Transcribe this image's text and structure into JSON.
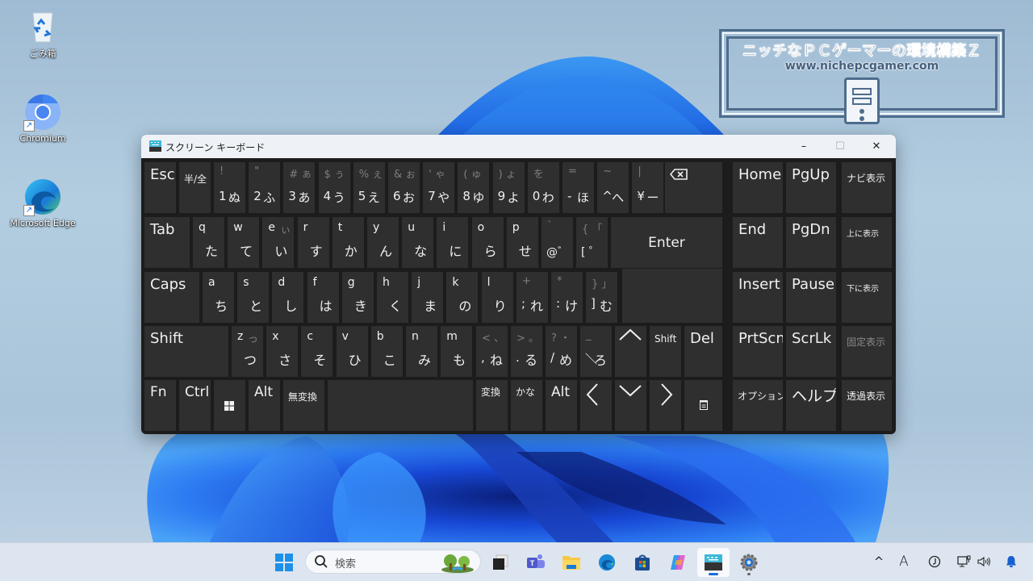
{
  "desktop": {
    "icons": [
      {
        "label": "ごみ箱",
        "icon": "recycle-bin-icon"
      },
      {
        "label": "Chromium",
        "icon": "chromium-icon",
        "shortcut": true
      },
      {
        "label": "Microsoft Edge",
        "icon": "edge-icon",
        "shortcut": true
      }
    ],
    "watermark": {
      "title": "ニッチなＰＣゲーマーの環境構築Ｚ",
      "url": "www.nichepcgamer.com"
    }
  },
  "osk": {
    "title": "スクリーン キーボード",
    "window_buttons": {
      "minimize": "–",
      "maximize": "☐",
      "close": "✕"
    },
    "row1": {
      "esc": "Esc",
      "hankaku": "半/全",
      "keys": [
        {
          "shift": "!",
          "sym": "1",
          "kana": "ぬ"
        },
        {
          "shift": "\"",
          "sym": "2",
          "kana": "ふ"
        },
        {
          "shift": "# ぁ",
          "sym": "3",
          "kana": "あ"
        },
        {
          "shift": "$ ぅ",
          "sym": "4",
          "kana": "う"
        },
        {
          "shift": "% ぇ",
          "sym": "5",
          "kana": "え"
        },
        {
          "shift": "& ぉ",
          "sym": "6",
          "kana": "お"
        },
        {
          "shift": "'  ゃ",
          "sym": "7",
          "kana": "や"
        },
        {
          "shift": "(  ゅ",
          "sym": "8",
          "kana": "ゆ"
        },
        {
          "shift": ")  ょ",
          "sym": "9",
          "kana": "よ"
        },
        {
          "shift": "   を",
          "sym": "0",
          "kana": "わ"
        },
        {
          "shift": "=",
          "sym": "-",
          "kana": "ほ"
        },
        {
          "shift": "~",
          "sym": "^",
          "kana": "へ"
        },
        {
          "shift": "|",
          "sym": "¥",
          "kana": "ー"
        }
      ],
      "backspace": "backspace-icon"
    },
    "row2": {
      "tab": "Tab",
      "keys": [
        {
          "letter": "q",
          "kana": "た"
        },
        {
          "letter": "w",
          "kana": "て"
        },
        {
          "letter": "e",
          "shift": "ぃ",
          "kana": "い"
        },
        {
          "letter": "r",
          "kana": "す"
        },
        {
          "letter": "t",
          "kana": "か"
        },
        {
          "letter": "y",
          "kana": "ん"
        },
        {
          "letter": "u",
          "kana": "な"
        },
        {
          "letter": "i",
          "kana": "に"
        },
        {
          "letter": "o",
          "kana": "ら"
        },
        {
          "letter": "p",
          "kana": "せ"
        }
      ],
      "at": {
        "shift": "`",
        "sym": "@゛"
      },
      "bracket": {
        "shift": "{ 「",
        "sym": "[ ゜"
      },
      "enter": "Enter"
    },
    "row3": {
      "caps": "Caps",
      "keys": [
        {
          "letter": "a",
          "kana": "ち"
        },
        {
          "letter": "s",
          "kana": "と"
        },
        {
          "letter": "d",
          "kana": "し"
        },
        {
          "letter": "f",
          "kana": "は"
        },
        {
          "letter": "g",
          "kana": "き"
        },
        {
          "letter": "h",
          "kana": "く"
        },
        {
          "letter": "j",
          "kana": "ま"
        },
        {
          "letter": "k",
          "kana": "の"
        },
        {
          "letter": "l",
          "kana": "り"
        }
      ],
      "semicolon": {
        "shift": "+",
        "sym": ";",
        "kana": "れ"
      },
      "colon": {
        "shift": "*",
        "sym": ":",
        "kana": "け"
      },
      "rbracket": {
        "shift": "}  」",
        "sym": "]",
        "kana": "む"
      }
    },
    "row4": {
      "shift": "Shift",
      "keys": [
        {
          "letter": "z",
          "shift": "っ",
          "kana": "つ"
        },
        {
          "letter": "x",
          "kana": "さ"
        },
        {
          "letter": "c",
          "kana": "そ"
        },
        {
          "letter": "v",
          "kana": "ひ"
        },
        {
          "letter": "b",
          "kana": "こ"
        },
        {
          "letter": "n",
          "kana": "み"
        },
        {
          "letter": "m",
          "kana": "も"
        }
      ],
      "comma": {
        "shift": "< 、",
        "sym": ",",
        "kana": "ね"
      },
      "period": {
        "shift": "> 。",
        "sym": ".",
        "kana": "る"
      },
      "slash": {
        "shift": "? ・",
        "sym": "/",
        "kana": "め"
      },
      "backslash": {
        "shift": "_",
        "sym": "＼",
        "kana": "ろ"
      },
      "up": "up-arrow-icon",
      "rshift": "Shift",
      "del": "Del"
    },
    "row5": {
      "fn": "Fn",
      "ctrl": "Ctrl",
      "win": "windows-icon",
      "alt": "Alt",
      "muhenkan": "無変換",
      "space": "",
      "henkan": "変換",
      "kana": "かな",
      "ralt": "Alt",
      "left": "left-arrow-icon",
      "down": "down-arrow-icon",
      "right": "right-arrow-icon",
      "menu": "context-menu-icon"
    },
    "nav": [
      [
        "Home",
        "PgUp"
      ],
      [
        "End",
        "PgDn"
      ],
      [
        "Insert",
        "Pause"
      ],
      [
        "PrtScn",
        "ScrLk"
      ],
      [
        "オプション",
        "ヘルプ"
      ]
    ],
    "side": [
      "ナビ表示",
      "上に表示",
      "下に表示",
      "固定表示",
      "透過表示"
    ]
  },
  "taskbar": {
    "search_placeholder": "検索",
    "items": [
      "start",
      "widgets-search-art",
      "task-view",
      "teams",
      "file-explorer",
      "edge",
      "store",
      "copilot",
      "on-screen-keyboard",
      "settings"
    ],
    "active": "on-screen-keyboard",
    "tray": {
      "ime": "A",
      "chevron": "^"
    }
  }
}
